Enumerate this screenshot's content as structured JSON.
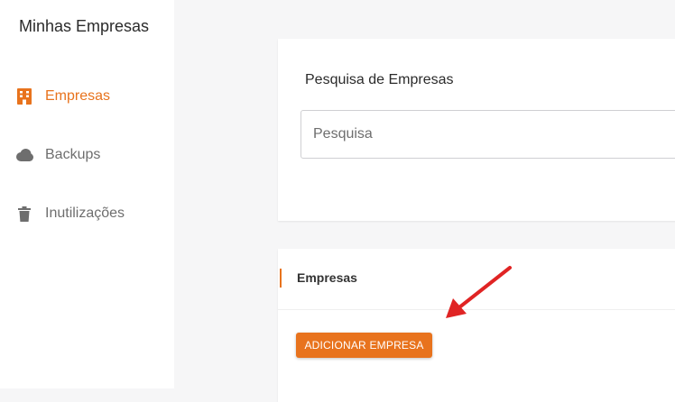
{
  "sidebar": {
    "title": "Minhas Empresas",
    "items": [
      {
        "label": "Empresas",
        "icon": "building-icon",
        "active": true
      },
      {
        "label": "Backups",
        "icon": "cloud-icon",
        "active": false
      },
      {
        "label": "Inutilizações",
        "icon": "trash-icon",
        "active": false
      }
    ]
  },
  "search": {
    "title": "Pesquisa de Empresas",
    "placeholder": "Pesquisa"
  },
  "list": {
    "title": "Empresas",
    "add_button_label": "ADICIONAR EMPRESA"
  },
  "colors": {
    "accent": "#e8731d",
    "annotation_arrow": "#e02424",
    "icon_gray": "#6e6e6e"
  }
}
